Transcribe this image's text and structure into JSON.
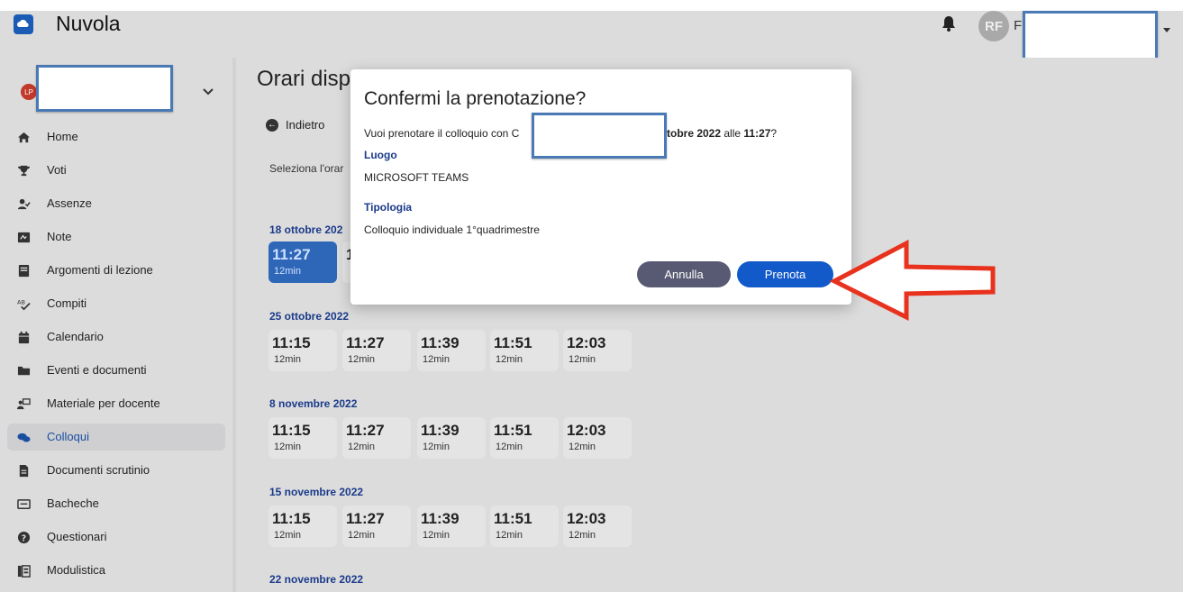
{
  "app": {
    "title": "Nuvola"
  },
  "header": {
    "user_initials": "RF",
    "user_name_initial": "F"
  },
  "sidebar": {
    "user_initials": "LP",
    "items": [
      {
        "label": "Home",
        "icon": "home-icon"
      },
      {
        "label": "Voti",
        "icon": "trophy-icon"
      },
      {
        "label": "Assenze",
        "icon": "user-check-icon"
      },
      {
        "label": "Note",
        "icon": "note-icon"
      },
      {
        "label": "Argomenti di lezione",
        "icon": "book-icon"
      },
      {
        "label": "Compiti",
        "icon": "spellcheck-icon"
      },
      {
        "label": "Calendario",
        "icon": "calendar-icon"
      },
      {
        "label": "Eventi e documenti",
        "icon": "folder-icon"
      },
      {
        "label": "Materiale per docente",
        "icon": "teacher-icon"
      },
      {
        "label": "Colloqui",
        "icon": "chat-icon",
        "active": true
      },
      {
        "label": "Documenti scrutinio",
        "icon": "document-icon"
      },
      {
        "label": "Bacheche",
        "icon": "board-icon"
      },
      {
        "label": "Questionari",
        "icon": "question-icon"
      },
      {
        "label": "Modulistica",
        "icon": "forms-icon"
      }
    ]
  },
  "main": {
    "title": "Orari disp",
    "back_label": "Indietro",
    "instruction": "Seleziona l'orar",
    "groups": [
      {
        "date": "18 ottobre 202",
        "slots": [
          {
            "time": "11:27",
            "dur": "12min",
            "selected": true
          },
          {
            "time": "1",
            "dur": ""
          }
        ]
      },
      {
        "date": "25 ottobre 2022",
        "slots": [
          {
            "time": "11:15",
            "dur": "12min"
          },
          {
            "time": "11:27",
            "dur": "12min"
          },
          {
            "time": "11:39",
            "dur": "12min"
          },
          {
            "time": "11:51",
            "dur": "12min"
          },
          {
            "time": "12:03",
            "dur": "12min"
          }
        ]
      },
      {
        "date": "8 novembre 2022",
        "slots": [
          {
            "time": "11:15",
            "dur": "12min"
          },
          {
            "time": "11:27",
            "dur": "12min"
          },
          {
            "time": "11:39",
            "dur": "12min"
          },
          {
            "time": "11:51",
            "dur": "12min"
          },
          {
            "time": "12:03",
            "dur": "12min"
          }
        ]
      },
      {
        "date": "15 novembre 2022",
        "slots": [
          {
            "time": "11:15",
            "dur": "12min"
          },
          {
            "time": "11:27",
            "dur": "12min"
          },
          {
            "time": "11:39",
            "dur": "12min"
          },
          {
            "time": "11:51",
            "dur": "12min"
          },
          {
            "time": "12:03",
            "dur": "12min"
          }
        ]
      },
      {
        "date": "22 novembre 2022",
        "slots": []
      }
    ]
  },
  "modal": {
    "title": "Confermi la prenotazione?",
    "question_prefix": "Vuoi prenotare il colloquio con C",
    "question_date": "ttobre 2022",
    "question_mid": " alle ",
    "question_time": "11:27",
    "question_end": "?",
    "luogo_label": "Luogo",
    "luogo_value": "MICROSOFT TEAMS",
    "tipologia_label": "Tipologia",
    "tipologia_value": "Colloquio individuale 1°quadrimestre",
    "cancel_label": "Annulla",
    "confirm_label": "Prenota"
  },
  "colors": {
    "accent": "#1259c9",
    "cancel": "#585a73",
    "arrow": "#e8321e",
    "selected_slot": "#2f67b8"
  }
}
